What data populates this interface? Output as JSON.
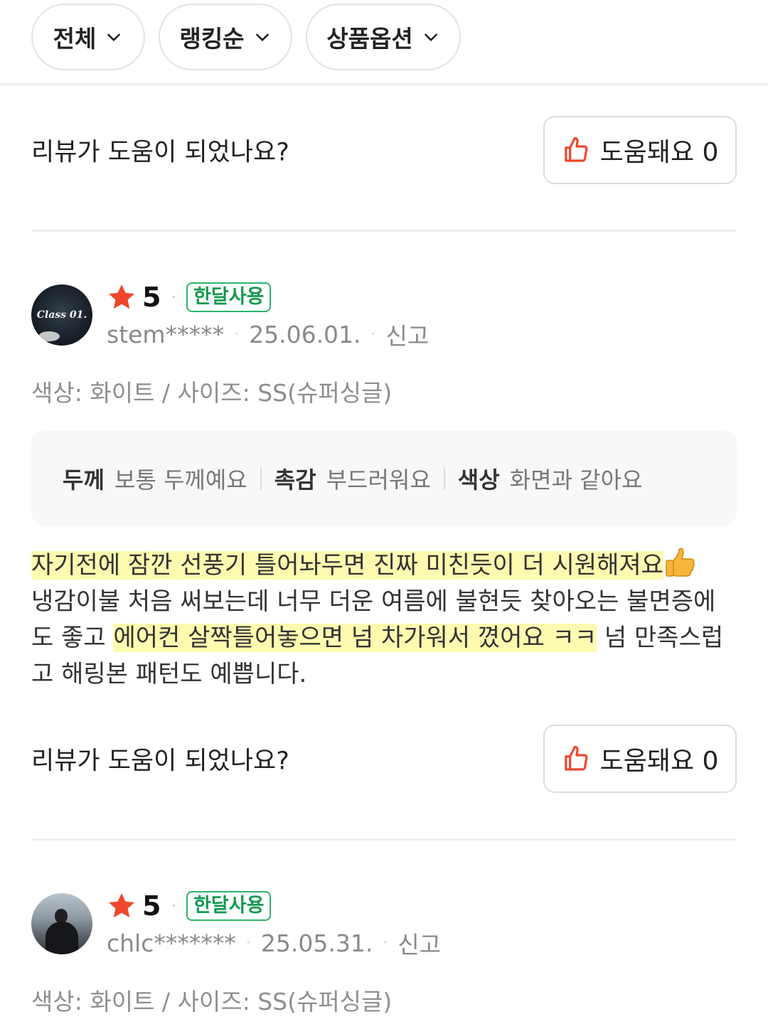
{
  "filters": [
    {
      "label": "전체"
    },
    {
      "label": "랭킹순"
    },
    {
      "label": "상품옵션"
    }
  ],
  "helpful": {
    "question": "리뷰가 도움이 되었나요?",
    "button_label": "도움돼요 0"
  },
  "reviews": [
    {
      "avatar_text": "Class 01.",
      "rating": "5",
      "badge": "한달사용",
      "user": "stem*****",
      "date": "25.06.01.",
      "report": "신고",
      "option": "색상: 화이트 / 사이즈: SS(슈퍼싱글)",
      "attributes": [
        {
          "key": "두께",
          "value": "보통 두께예요"
        },
        {
          "key": "촉감",
          "value": "부드러워요"
        },
        {
          "key": "색상",
          "value": "화면과 같아요"
        }
      ],
      "body_highlight_1": "자기전에 잠깐 선풍기 틀어놔두면 진짜 미친듯이 더 시원해져요",
      "body_plain_1": "냉감이불 처음 써보는데 너무 더운 여름에 불현듯 찾아오는 불면증에도 좋고 ",
      "body_highlight_2": "에어컨 살짝틀어놓으면 넘 차가워서 꼈어요 ㅋㅋ",
      "body_plain_2": " 넘 만족스럽고 해링본 패턴도 예쁩니다.",
      "body_emoji": "thumbs-up-emoji"
    },
    {
      "rating": "5",
      "badge": "한달사용",
      "user": "chlc*******",
      "date": "25.05.31.",
      "report": "신고",
      "option": "색상: 화이트 / 사이즈: SS(슈퍼싱글)"
    }
  ],
  "colors": {
    "star": "#f0462d",
    "badge": "#2bb36b",
    "like_icon": "#f0462d",
    "highlight": "#fdfbb0"
  },
  "icons": {
    "chevron": "chevron-down-icon",
    "like": "thumbs-up-icon",
    "star": "star-icon"
  }
}
